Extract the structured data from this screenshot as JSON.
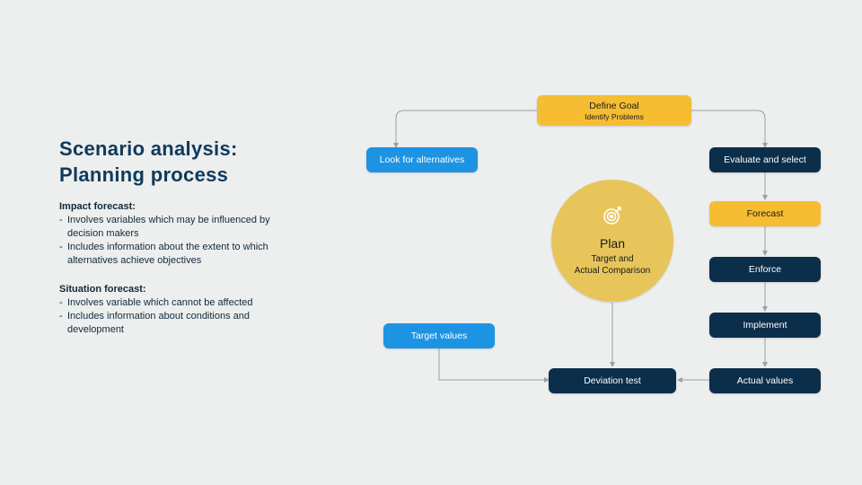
{
  "title_line1": "Scenario analysis:",
  "title_line2": "Planning process",
  "sections": {
    "impact": {
      "heading": "Impact forecast:",
      "b1": "Involves variables which may be influenced by decision makers",
      "b2": "Includes information about the extent to which alternatives achieve objectives"
    },
    "situation": {
      "heading": "Situation forecast:",
      "b1": "Involves variable which cannot be affected",
      "b2": "Includes information about conditions and development"
    }
  },
  "nodes": {
    "define_goal": "Define Goal",
    "define_goal_sub": "Identify Problems",
    "look_alt": "Look for alternatives",
    "evaluate": "Evaluate and select",
    "forecast": "Forecast",
    "enforce": "Enforce",
    "implement": "Implement",
    "actual": "Actual values",
    "targetvals": "Target values",
    "deviation": "Deviation test"
  },
  "circle": {
    "title": "Plan",
    "sub1": "Target and",
    "sub2": "Actual Comparison"
  },
  "colors": {
    "bg": "#edeeee",
    "navy": "#0b2e4a",
    "blue": "#1d93e3",
    "amber": "#f6bd33",
    "circle": "#e8c55a",
    "title": "#0e3a5c"
  },
  "chart_data": {
    "type": "flowchart",
    "title": "Scenario analysis: Planning process",
    "nodes": [
      {
        "id": "define_goal",
        "label": "Define Goal",
        "sub": "Identify Problems",
        "color": "amber"
      },
      {
        "id": "look_alt",
        "label": "Look for alternatives",
        "color": "blue"
      },
      {
        "id": "evaluate",
        "label": "Evaluate and select",
        "color": "navy"
      },
      {
        "id": "forecast",
        "label": "Forecast",
        "color": "amber"
      },
      {
        "id": "enforce",
        "label": "Enforce",
        "color": "navy"
      },
      {
        "id": "implement",
        "label": "Implement",
        "color": "navy"
      },
      {
        "id": "actual",
        "label": "Actual values",
        "color": "navy"
      },
      {
        "id": "targetvals",
        "label": "Target values",
        "color": "blue"
      },
      {
        "id": "deviation",
        "label": "Deviation test",
        "color": "navy"
      },
      {
        "id": "plan",
        "label": "Plan",
        "sub": "Target and Actual Comparison",
        "shape": "circle",
        "color": "circle"
      }
    ],
    "edges": [
      {
        "from": "define_goal",
        "to": "look_alt"
      },
      {
        "from": "define_goal",
        "to": "evaluate"
      },
      {
        "from": "evaluate",
        "to": "forecast"
      },
      {
        "from": "forecast",
        "to": "enforce"
      },
      {
        "from": "enforce",
        "to": "implement"
      },
      {
        "from": "implement",
        "to": "actual"
      },
      {
        "from": "actual",
        "to": "deviation"
      },
      {
        "from": "targetvals",
        "to": "deviation"
      },
      {
        "from": "plan",
        "to": "deviation"
      }
    ]
  }
}
